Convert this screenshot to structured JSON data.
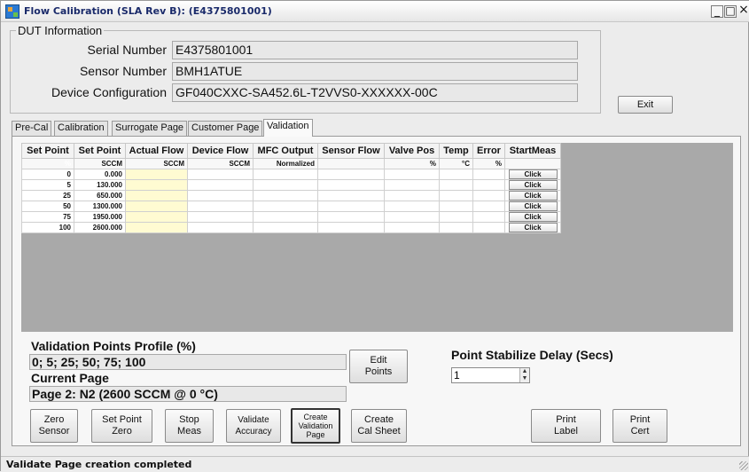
{
  "window": {
    "title": "Flow Calibration (SLA Rev B): (E4375801001)",
    "buttons": {
      "minimize": "_",
      "maximize": "□",
      "close": "×"
    }
  },
  "dut": {
    "legend": "DUT Information",
    "serial_label": "Serial Number",
    "serial_value": "E4375801001",
    "sensor_label": "Sensor Number",
    "sensor_value": "BMH1ATUE",
    "config_label": "Device Configuration",
    "config_value": "GF040CXXC-SA452.6L-T2VVS0-XXXXXX-00C"
  },
  "exit_label": "Exit",
  "tabs": [
    {
      "label": "Pre-Cal",
      "active": false
    },
    {
      "label": "Calibration",
      "active": false
    },
    {
      "label": "Surrogate Page",
      "active": false
    },
    {
      "label": "Customer Page",
      "active": false
    },
    {
      "label": "Validation",
      "active": true
    }
  ],
  "grid": {
    "headers": [
      "Set Point",
      "Set Point",
      "Actual Flow",
      "Device Flow",
      "MFC Output",
      "Sensor Flow",
      "Valve Pos",
      "Temp",
      "Error",
      "StartMeas"
    ],
    "units": [
      "%",
      "SCCM",
      "SCCM",
      "SCCM",
      "Normalized",
      "",
      "%",
      "°C",
      "%",
      ""
    ],
    "rows": [
      {
        "pct": "0",
        "sccm": "0.000",
        "action": "Click"
      },
      {
        "pct": "5",
        "sccm": "130.000",
        "action": "Click"
      },
      {
        "pct": "25",
        "sccm": "650.000",
        "action": "Click"
      },
      {
        "pct": "50",
        "sccm": "1300.000",
        "action": "Click"
      },
      {
        "pct": "75",
        "sccm": "1950.000",
        "action": "Click"
      },
      {
        "pct": "100",
        "sccm": "2600.000",
        "action": "Click"
      }
    ]
  },
  "validation": {
    "profile_label": "Validation Points Profile (%)",
    "profile_value": "0; 5; 25; 50; 75; 100",
    "current_page_label": "Current Page",
    "current_page_value": "Page 2: N2 (2600 SCCM @ 0 °C)",
    "edit_points": [
      "Edit",
      "Points"
    ],
    "delay_label": "Point Stabilize Delay (Secs)",
    "delay_value": "1"
  },
  "buttons": {
    "zero_sensor": [
      "Zero",
      "Sensor"
    ],
    "set_point_zero": [
      "Set Point",
      "Zero"
    ],
    "stop_meas": [
      "Stop",
      "Meas"
    ],
    "validate_accuracy": [
      "Validate",
      "Accuracy"
    ],
    "create_validation_page": [
      "Create",
      "Validation",
      "Page"
    ],
    "create_cal_sheet": [
      "Create",
      "Cal Sheet"
    ],
    "print_label": [
      "Print",
      "Label"
    ],
    "print_cert": [
      "Print",
      "Cert"
    ]
  },
  "status": "Validate Page creation completed"
}
